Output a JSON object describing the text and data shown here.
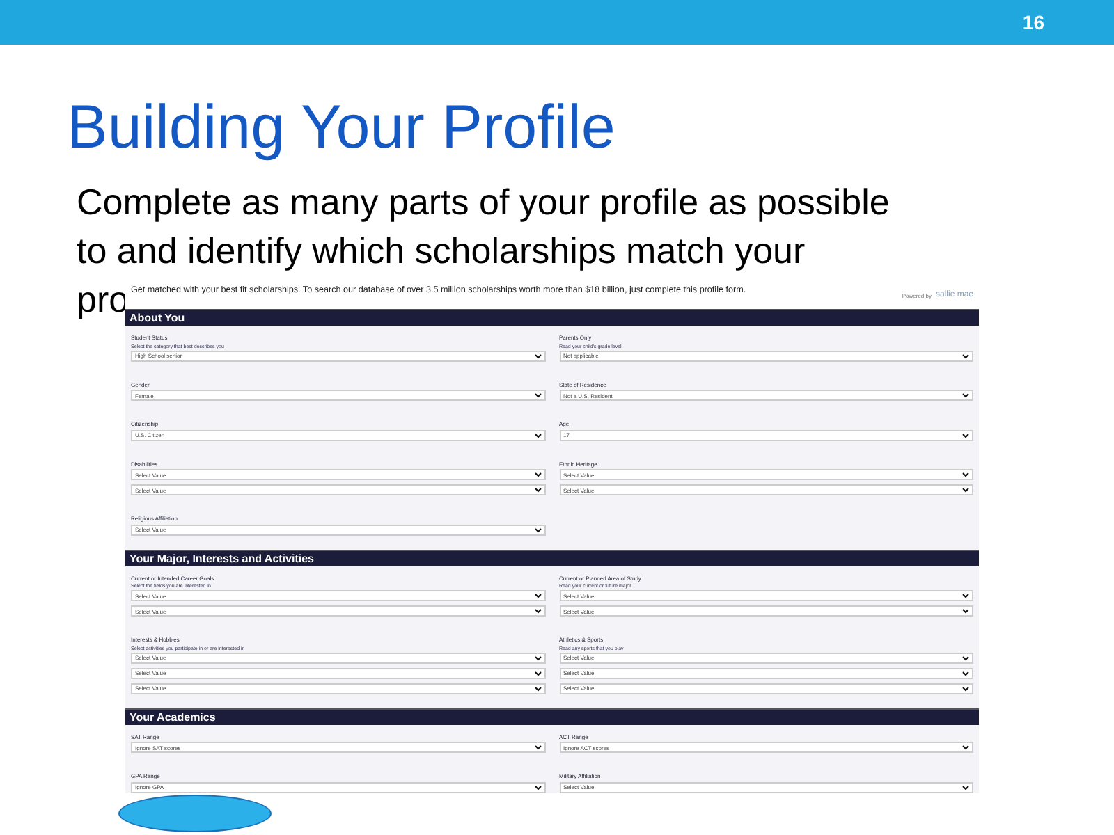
{
  "slide_number": "16",
  "title": "Building Your Profile",
  "body_lines": [
    "Complete as many parts of your profile as possible",
    "to and identify which scholarships match your",
    "pro"
  ],
  "form": {
    "intro": "Get matched with your best fit scholarships. To search our database of over 3.5 million scholarships worth more than $18 billion, just complete this profile form.",
    "powered_by": "Powered by",
    "logo": "sallie mae",
    "sections": [
      {
        "title": "About You",
        "fields": [
          {
            "label": "Student Status",
            "hint": "Select the category that best describes you",
            "selects": [
              "High School senior"
            ]
          },
          {
            "label": "Parents Only",
            "hint": "Read your child's grade level",
            "selects": [
              "Not applicable"
            ]
          },
          {
            "label": "Gender",
            "selects": [
              "Female"
            ]
          },
          {
            "label": "State of Residence",
            "selects": [
              "Not a U.S. Resident"
            ]
          },
          {
            "label": "Citizenship",
            "selects": [
              "U.S. Citizen"
            ]
          },
          {
            "label": "Age",
            "selects": [
              "17"
            ]
          },
          {
            "label": "Disabilities",
            "selects": [
              "Select Value",
              "Select Value"
            ]
          },
          {
            "label": "Ethnic Heritage",
            "selects": [
              "Select Value",
              "Select Value"
            ]
          },
          {
            "label": "Religious Affiliation",
            "selects": [
              "Select Value"
            ]
          }
        ]
      },
      {
        "title": "Your Major, Interests and Activities",
        "fields": [
          {
            "label": "Current or Intended Career Goals",
            "hint": "Select the fields you are interested in",
            "selects": [
              "Select Value",
              "Select Value"
            ]
          },
          {
            "label": "Current or Planned Area of Study",
            "hint": "Read your current or future major",
            "selects": [
              "Select Value",
              "Select Value"
            ]
          },
          {
            "label": "Interests & Hobbies",
            "hint": "Select activities you participate in or are interested in",
            "selects": [
              "Select Value",
              "Select Value",
              "Select Value"
            ]
          },
          {
            "label": "Athletics & Sports",
            "hint": "Read any sports that you play",
            "selects": [
              "Select Value",
              "Select Value",
              "Select Value"
            ]
          }
        ]
      },
      {
        "title": "Your Academics",
        "fields": [
          {
            "label": "SAT Range",
            "selects": [
              "Ignore SAT scores"
            ]
          },
          {
            "label": "ACT Range",
            "selects": [
              "Ignore ACT scores"
            ]
          },
          {
            "label": "GPA Range",
            "selects": [
              "Ignore GPA"
            ]
          },
          {
            "label": "Military Affiliation",
            "selects": [
              "Select Value"
            ]
          }
        ]
      }
    ]
  }
}
